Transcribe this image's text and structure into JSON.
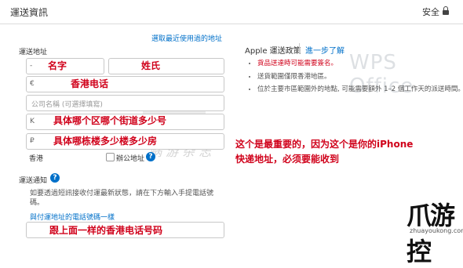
{
  "header": {
    "title": "運送資訊",
    "secure_label": "安全"
  },
  "shipping": {
    "recent_link": "選取最近使用過的地址",
    "section_label": "運送地址",
    "first_name_prefix": "-",
    "first_name_annotation": "名字",
    "last_name_annotation": "姓氏",
    "phone_prefix": "€",
    "phone_annotation": "香港电话",
    "company_placeholder": "公司名稱 (可選擇填寫)",
    "street_prefix": "K",
    "street_annotation": "具体哪个区哪个街道多少号",
    "building_prefix": "₽",
    "building_annotation": "具体哪栋楼多少楼多少房",
    "region": "香港",
    "company_address_label": "辦公地址"
  },
  "notify": {
    "label": "運送通知",
    "description": "如要透過短訊接收付運最新狀態，請在下方輸入手提電話號碼。",
    "same_phone_link": "與付運地址的電話號碼一樣",
    "phone_annotation": "跟上面一样的香港电话号码"
  },
  "policy": {
    "title": "Apple 運送政策",
    "more_link": "進一步了解",
    "items": [
      {
        "text": "貨品送達時可能需要簽名。",
        "highlight": true
      },
      {
        "text": "送貨範圍僅限香港地區。",
        "highlight": false
      },
      {
        "text": "位於主要市區範圍外的地點, 可能需要額外 1–2 個工作天的派送時間。",
        "highlight": false
      }
    ]
  },
  "annotation": {
    "line1": "这个是最重要的，因为这个是你的iPhone",
    "line2": "快递地址，必须要能收到"
  },
  "watermark": {
    "wps": "WPS Office",
    "script": "蜗 游 杂 志",
    "logo": "爪游控",
    "logo_url": "zhuayoukong.com"
  }
}
